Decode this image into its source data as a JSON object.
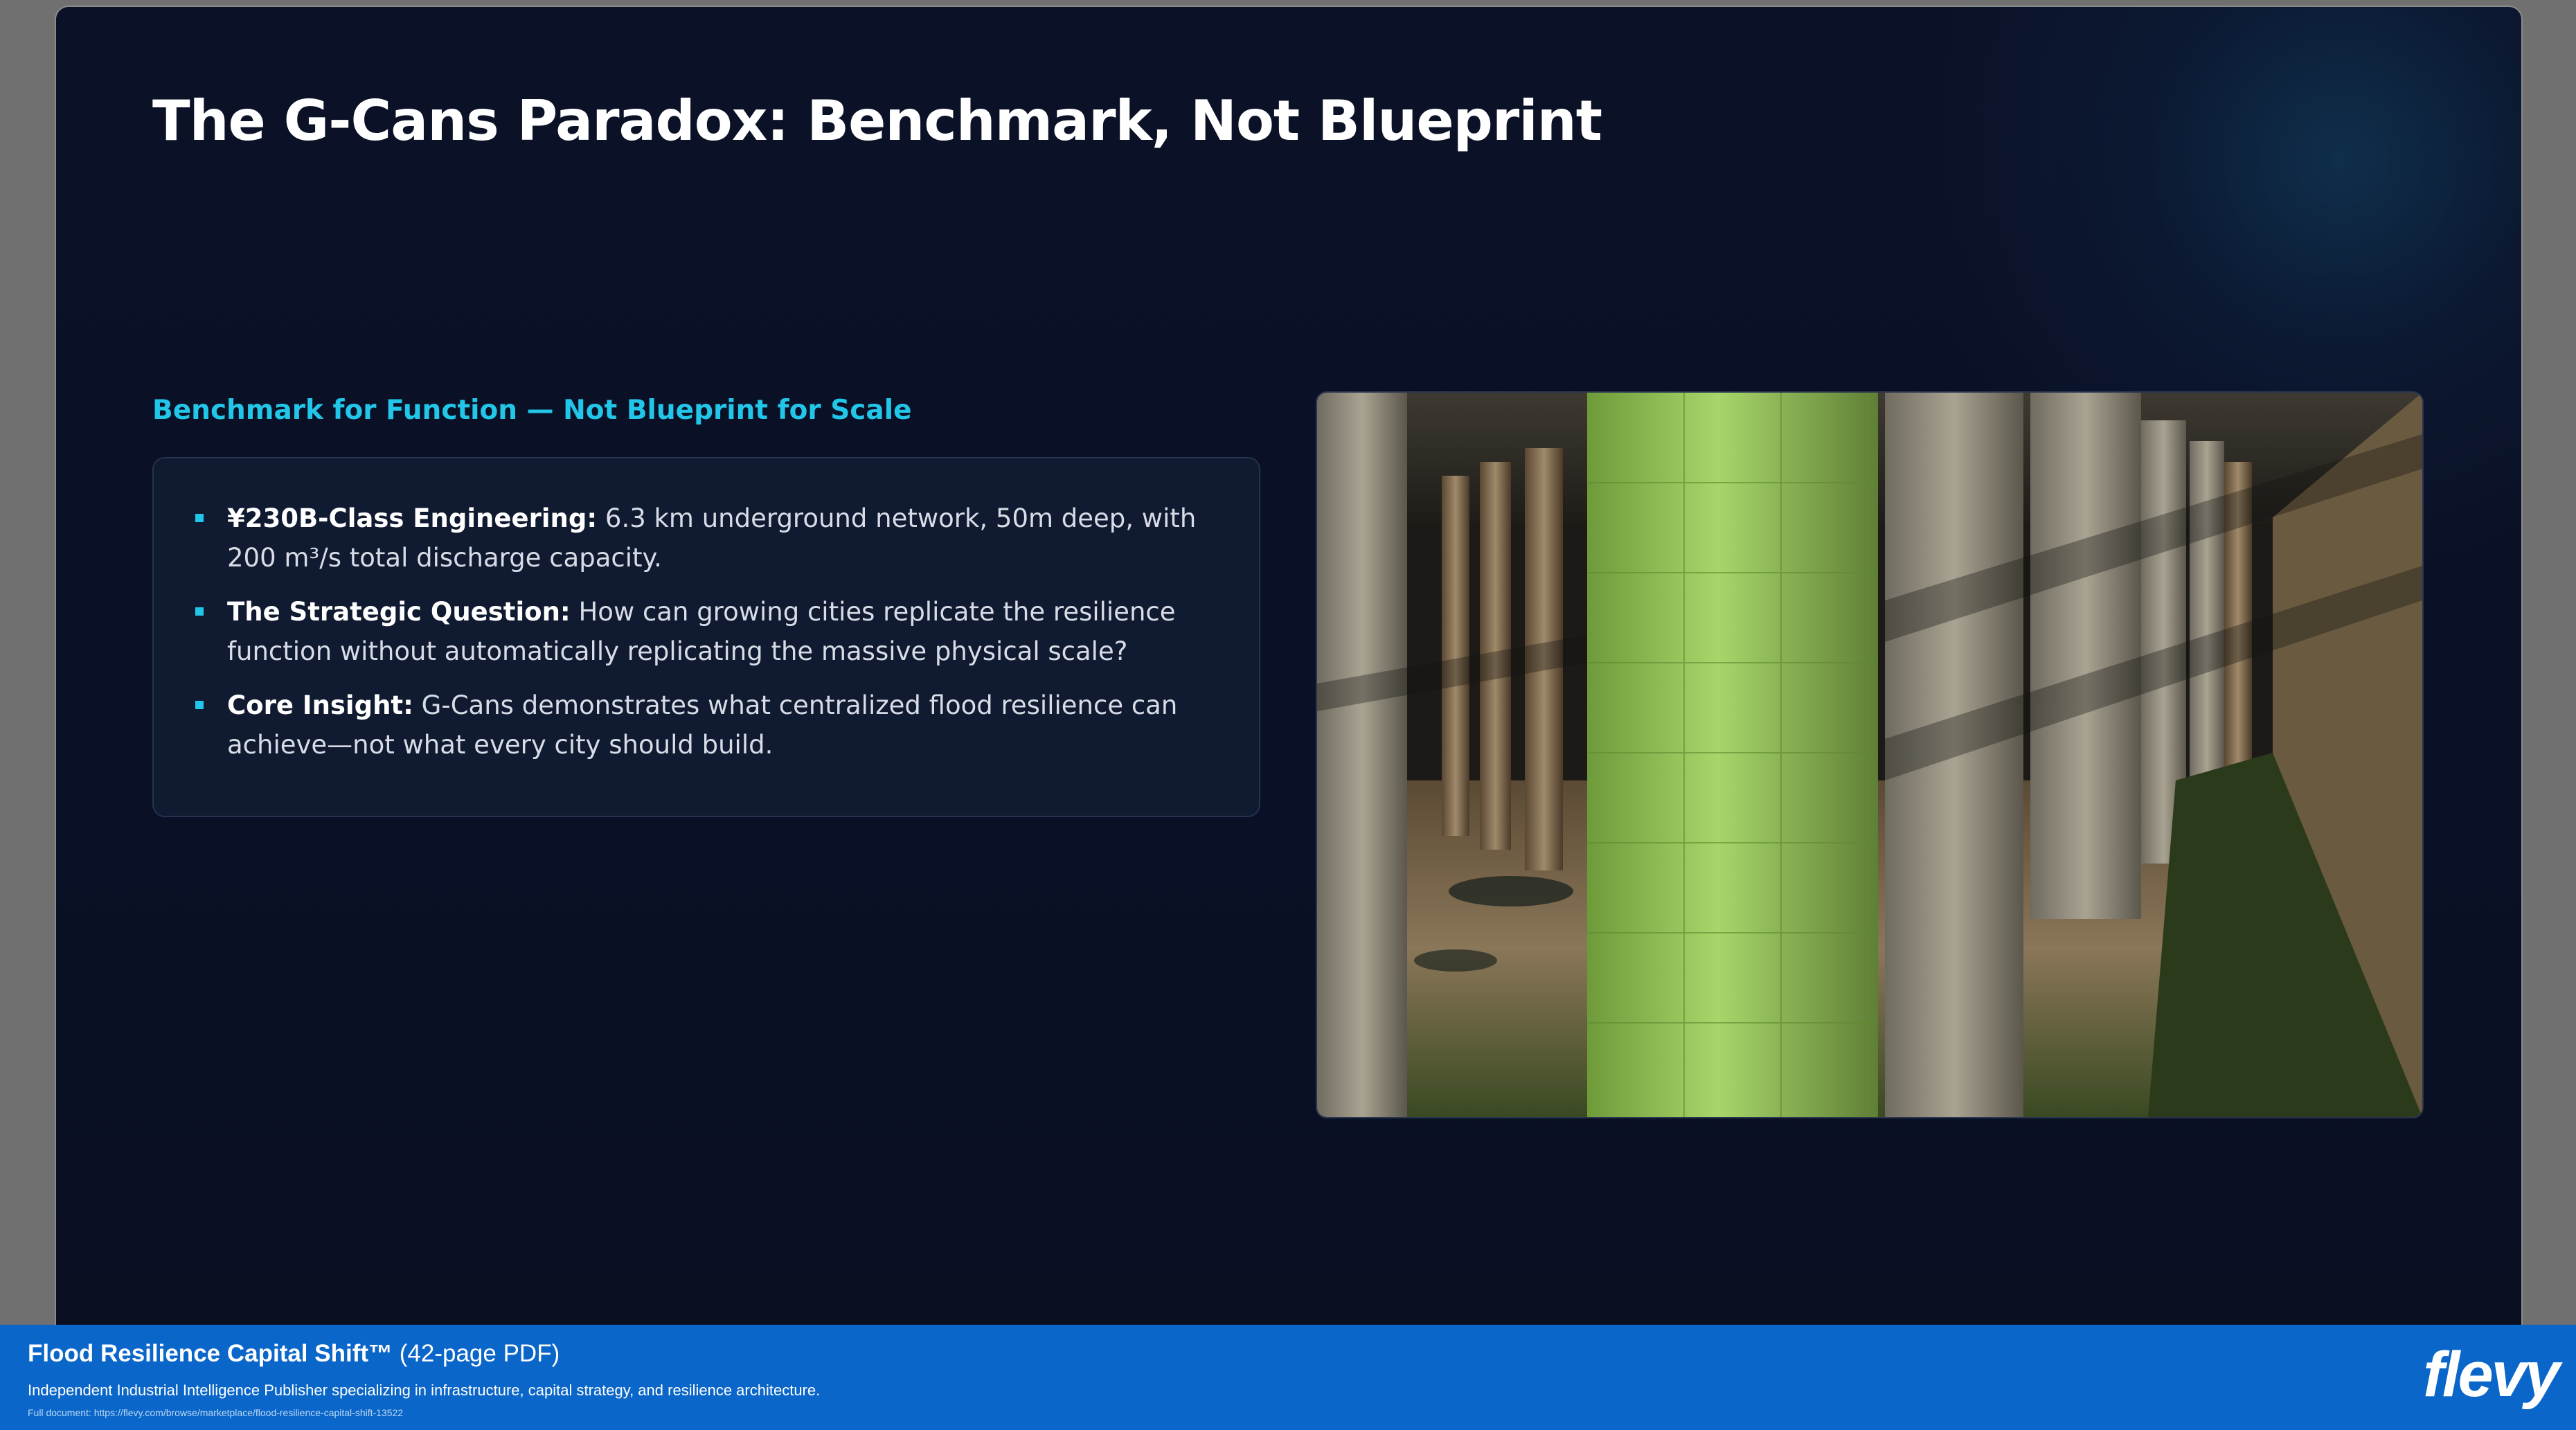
{
  "slide": {
    "title": "The G-Cans Paradox: Benchmark, Not Blueprint",
    "section_heading": "Benchmark for Function — Not Blueprint for Scale",
    "bullets": [
      {
        "lead": "¥230B-Class Engineering:",
        "text": " 6.3 km underground network, 50m deep, with 200 m³/s total discharge capacity."
      },
      {
        "lead": "The Strategic Question:",
        "text": " How can growing cities replicate the resilience function without automatically replicating the massive physical scale?"
      },
      {
        "lead": "Core Insight:",
        "text": " G-Cans demonstrates what centralized flood resilience can achieve—not what every city should build."
      }
    ],
    "accent_color": "#22c6e8",
    "background_color": "#0a1025"
  },
  "footer": {
    "title": "Flood Resilience Capital Shift™",
    "title_suffix": " (42-page PDF)",
    "description": "Independent Industrial Intelligence Publisher specializing in infrastructure, capital strategy, and resilience architecture.",
    "link": "Full document: https://flevy.com/browse/marketplace/flood-resilience-capital-shift-13522",
    "logo": "flevy",
    "background_color": "#0a66c8"
  }
}
